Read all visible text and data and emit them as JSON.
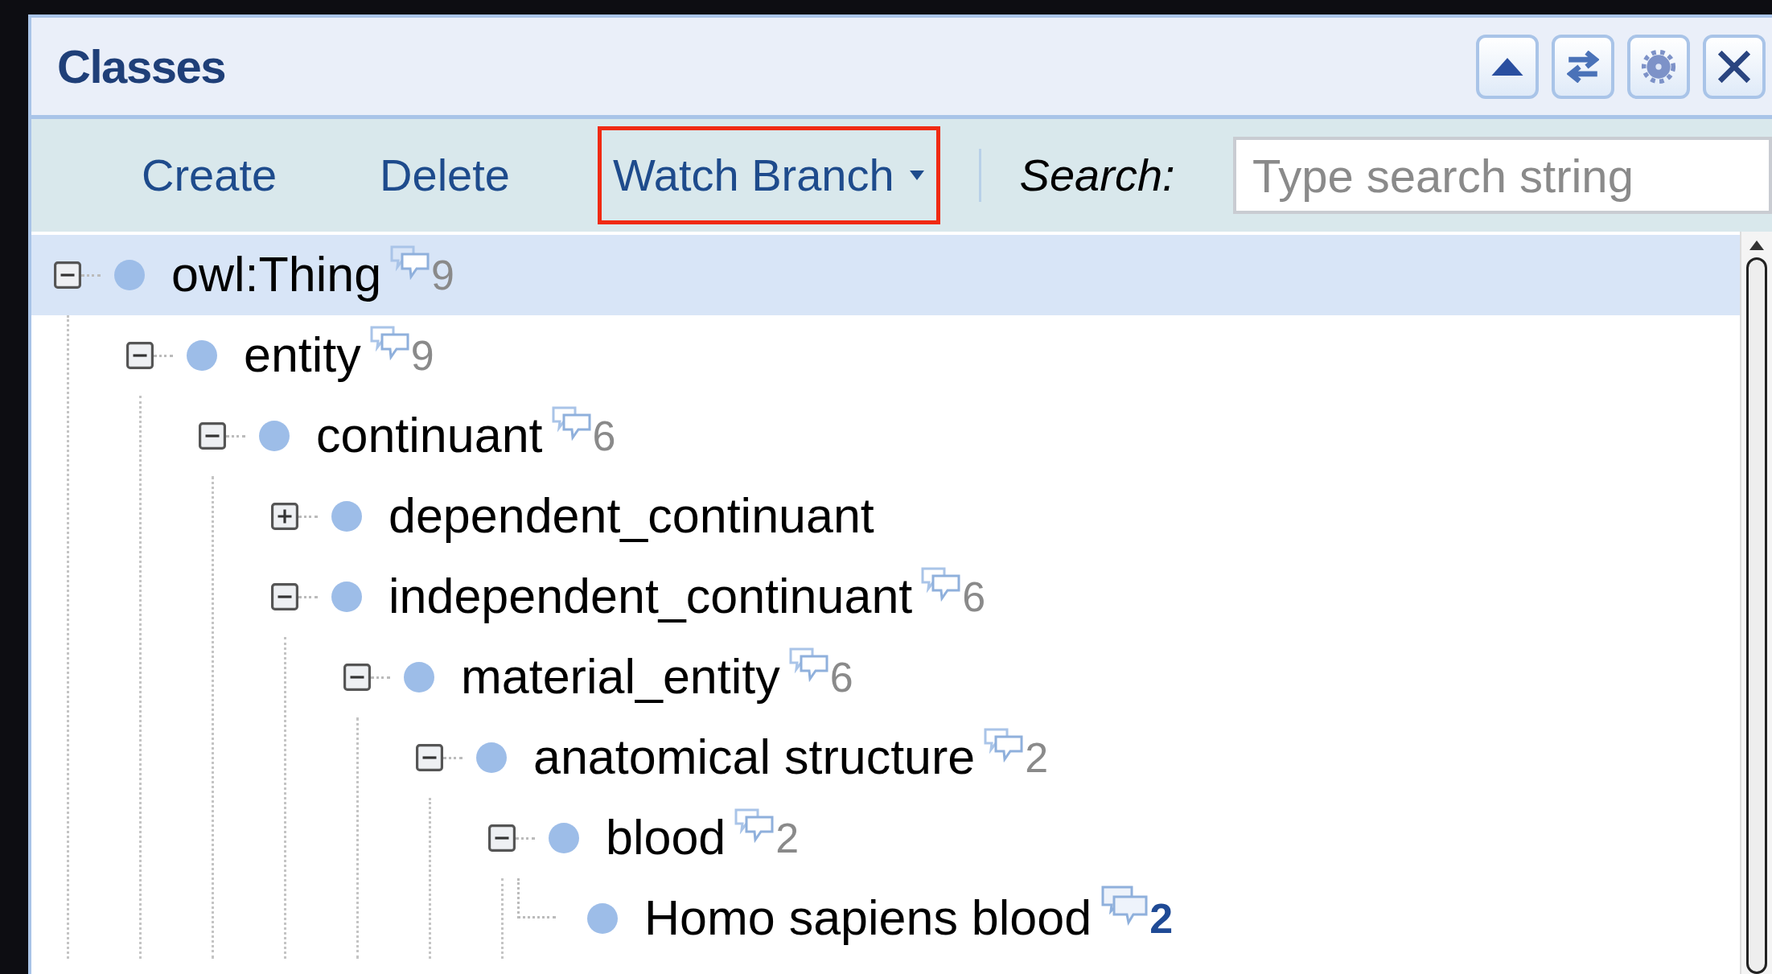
{
  "panel": {
    "title": "Classes"
  },
  "header_buttons": [
    {
      "kind": "collapse"
    },
    {
      "kind": "swap"
    },
    {
      "kind": "settings"
    },
    {
      "kind": "close"
    }
  ],
  "toolbar": {
    "buttons": [
      {
        "label": "Create",
        "dropdown": false,
        "highlighted": false
      },
      {
        "label": "Delete",
        "dropdown": false,
        "highlighted": false
      },
      {
        "label": "Watch Branch",
        "dropdown": true,
        "highlighted": true
      }
    ],
    "search_label": "Search:",
    "search": {
      "placeholder": "Type search string"
    }
  },
  "tree": [
    {
      "label": "owl:Thing",
      "kind": "folder",
      "expanded": true,
      "selected": true,
      "comments": "9",
      "unread": false,
      "children": [
        {
          "label": "entity",
          "kind": "folder",
          "expanded": true,
          "selected": false,
          "comments": "9",
          "unread": false,
          "children": [
            {
              "label": "continuant",
              "kind": "folder",
              "expanded": true,
              "selected": false,
              "comments": "6",
              "unread": false,
              "children": [
                {
                  "label": "dependent_continuant",
                  "kind": "folder",
                  "expanded": false,
                  "selected": false
                },
                {
                  "label": "independent_continuant",
                  "kind": "folder",
                  "expanded": true,
                  "selected": false,
                  "comments": "6",
                  "unread": false,
                  "children": [
                    {
                      "label": "material_entity",
                      "kind": "folder",
                      "expanded": true,
                      "selected": false,
                      "comments": "6",
                      "unread": false,
                      "children": [
                        {
                          "label": "anatomical structure",
                          "kind": "folder",
                          "expanded": true,
                          "selected": false,
                          "comments": "2",
                          "unread": false,
                          "children": [
                            {
                              "label": "blood",
                              "kind": "folder",
                              "expanded": true,
                              "selected": false,
                              "comments": "2",
                              "unread": false,
                              "children": [
                                {
                                  "label": "Homo sapiens blood",
                                  "kind": "leaf",
                                  "selected": false,
                                  "comments": "2",
                                  "unread": true
                                }
                              ]
                            }
                          ]
                        }
                      ]
                    }
                  ]
                }
              ]
            }
          ]
        }
      ]
    }
  ]
}
